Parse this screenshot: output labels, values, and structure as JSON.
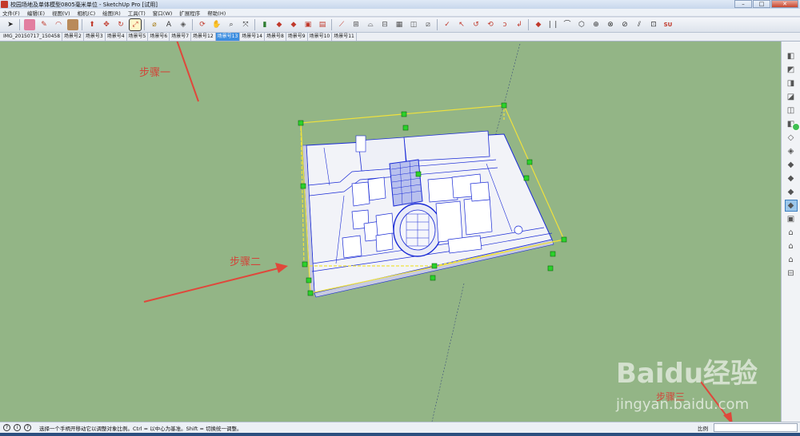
{
  "window": {
    "title": "校园场地及单体模型0805毫米单位 - SketchUp  Pro [试用]",
    "controls": [
      "–",
      "□",
      "✕"
    ]
  },
  "menu": [
    "文件(F)",
    "编辑(E)",
    "视图(V)",
    "相机(C)",
    "绘图(R)",
    "工具(T)",
    "窗口(W)",
    "扩展程序",
    "帮助(H)"
  ],
  "toolbar": {
    "icons": [
      "select-icon",
      "eraser-icon",
      "pencil-icon",
      "arc-icon",
      "rectangle-icon",
      "push-pull-icon",
      "move-icon",
      "rotate-icon",
      "scale-icon",
      "tape-icon",
      "text-icon",
      "orbit-icon",
      "pan-icon",
      "zoom-icon",
      "zoom-extents-icon"
    ]
  },
  "tabs": [
    "IMG_20150717_150458",
    "场景号2",
    "场景号3",
    "场景号4",
    "场景号5",
    "场景号6",
    "场景号7",
    "场景号12",
    "场景号13",
    "场景号14",
    "场景号8",
    "场景号9",
    "场景号10",
    "场景号11"
  ],
  "active_tab_index": 8,
  "annotations": {
    "step1": "步骤一",
    "step2": "步骤二",
    "step3": "步骤三"
  },
  "status": {
    "message": "选择一个手柄开移动它以调整对象比例。Ctrl = 以中心为基准。Shift = 切换统一调整。",
    "scale_label": "比例",
    "scale_value": ""
  },
  "watermark": {
    "logo": "Baidu经验",
    "url": "jingyan.baidu.com"
  },
  "colors": {
    "viewport_bg": "#93b586",
    "selection": "#f0e23c",
    "grip": "#2bd12b",
    "model_lines": "#1a2bd6",
    "arrow": "#e0473b"
  }
}
